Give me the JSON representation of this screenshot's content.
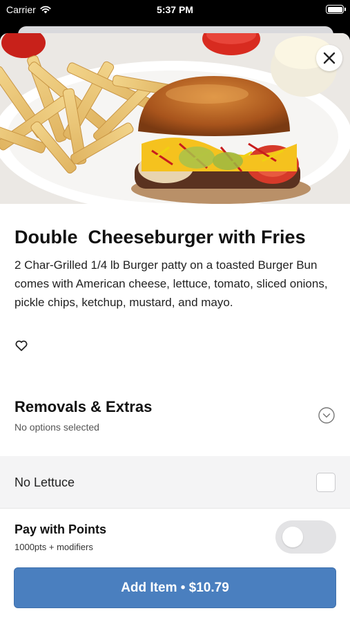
{
  "status_bar": {
    "carrier": "Carrier",
    "time": "5:37 PM"
  },
  "item": {
    "title": "Double  Cheeseburger with Fries",
    "description": "2 Char-Grilled 1/4 lb Burger patty on a toasted Burger Bun comes with American cheese, lettuce, tomato, sliced onions, pickle chips, ketchup, mustard, and mayo."
  },
  "modifiers": {
    "section_title": "Removals & Extras",
    "section_subtitle": "No options selected",
    "options": [
      {
        "label": "No Lettuce",
        "checked": false
      }
    ]
  },
  "points": {
    "title": "Pay with Points",
    "subtitle": "1000pts + modifiers",
    "enabled": false
  },
  "add_button": {
    "label": "Add Item • $10.79"
  },
  "colors": {
    "accent": "#4a7fbf",
    "toggle_off": "#e3e3e5"
  },
  "icons": [
    "wifi-icon",
    "battery-icon",
    "close-icon",
    "heart-icon",
    "chevron-down-icon"
  ]
}
